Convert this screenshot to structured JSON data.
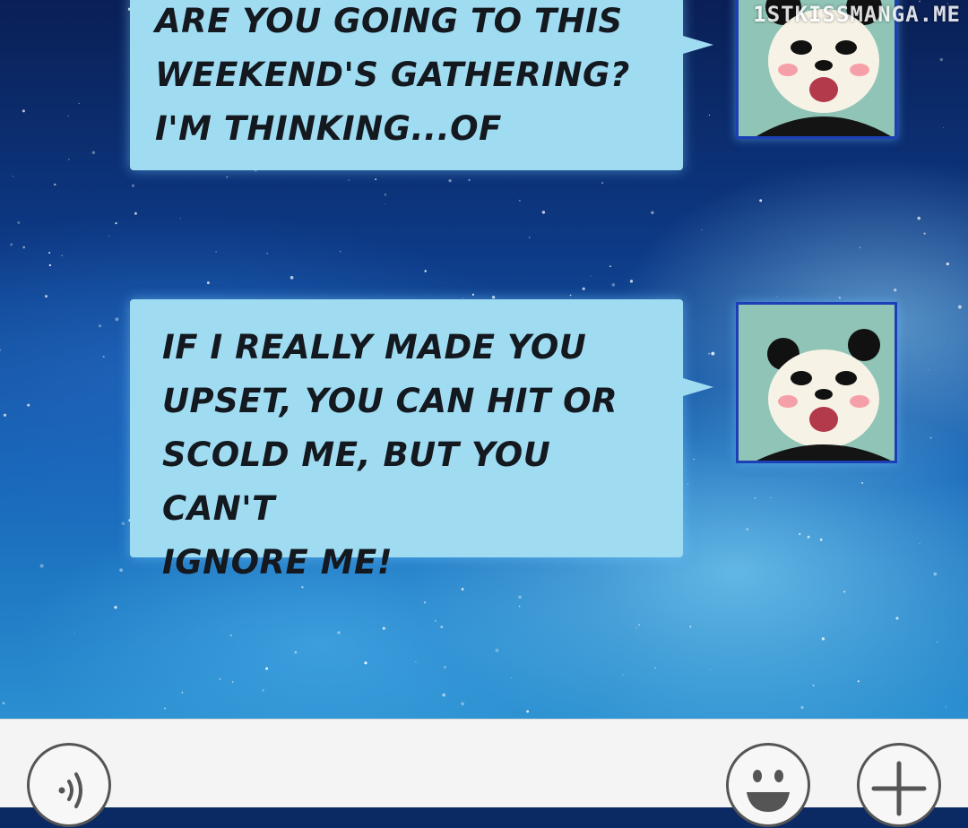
{
  "watermark": "1STKISSMANGA.ME",
  "messages": [
    {
      "text": "ARE YOU GOING TO THIS\nWEEKEND'S GATHERING?\nI'M THINKING...OF",
      "sender_avatar": "panda-avatar-icon"
    },
    {
      "text": "IF I REALLY MADE YOU\nUPSET, YOU CAN HIT OR\nSCOLD ME, BUT YOU CAN'T\nIGNORE ME!",
      "sender_avatar": "panda-avatar-icon"
    }
  ],
  "toolbar": {
    "voice_icon": "voice-input-icon",
    "emoji_icon": "smiley-emoji-icon",
    "more_icon": "plus-icon"
  },
  "colors": {
    "bubble": "#9fdcf2",
    "avatar_border": "#1c3fb5",
    "toolbar": "#f4f4f4"
  }
}
